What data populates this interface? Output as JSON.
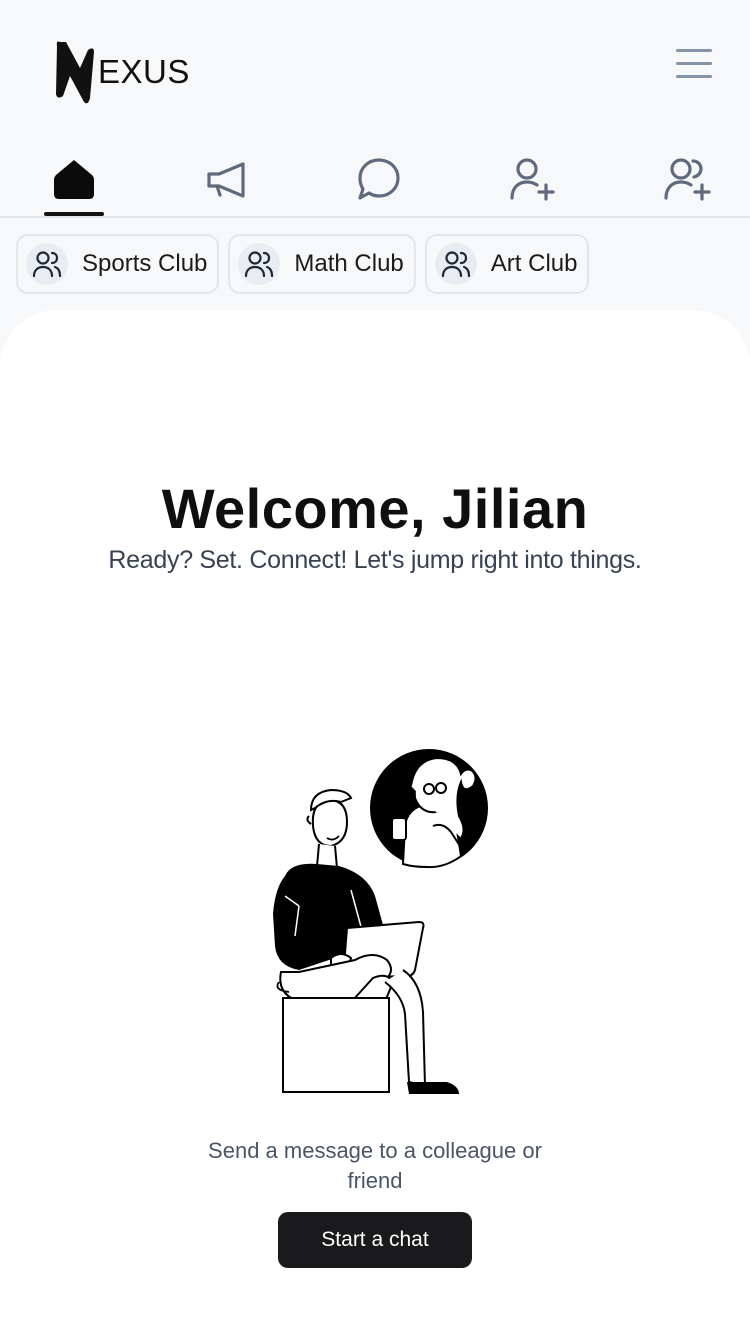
{
  "app": {
    "logo_text": "EXUS",
    "menu_icon": "hamburger-menu-icon"
  },
  "nav": {
    "tabs": [
      {
        "name": "home",
        "icon": "home-icon",
        "active": true
      },
      {
        "name": "announcements",
        "icon": "megaphone-icon",
        "active": false
      },
      {
        "name": "chat",
        "icon": "chat-bubble-icon",
        "active": false
      },
      {
        "name": "add-user",
        "icon": "user-plus-icon",
        "active": false
      },
      {
        "name": "add-group",
        "icon": "users-plus-icon",
        "active": false
      }
    ]
  },
  "clubs": [
    {
      "label": "Sports Club",
      "icon": "users-icon"
    },
    {
      "label": "Math Club",
      "icon": "users-icon"
    },
    {
      "label": "Art Club",
      "icon": "users-icon"
    }
  ],
  "main": {
    "welcome": "Welcome, Jilian",
    "subtitle": "Ready? Set. Connect! Let's jump right into things.",
    "prompt": "Send a message to a colleague or friend",
    "start_button": "Start a chat"
  },
  "colors": {
    "background": "#f7f8fa",
    "card": "#ffffff",
    "accent": "#1a1a1c",
    "icon_gray": "#5f6b7d"
  }
}
